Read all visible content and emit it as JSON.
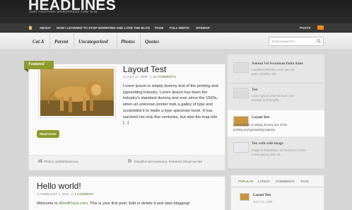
{
  "header": {
    "site_title": "HEADLINES",
    "tagline": "JUST ANOTHER WORDPRESS.COM SITE"
  },
  "topnav": {
    "items": [
      "ABOUT",
      "HOW I LEARNED TO STOP WORRYING AND LOVE THE BLOG",
      "PAGE",
      "FULL-WIDTH",
      "SITEMAP"
    ],
    "posts_label": "POSTS"
  },
  "categories": [
    "Cat A",
    "Parent",
    "Uncategorized",
    "Photos",
    "Quotes"
  ],
  "search": {
    "placeholder": "Enter keywords..."
  },
  "featured_post": {
    "tag": "Featured",
    "title": "Layout Test",
    "date": "JULY 27, 2009",
    "comments": "14 COMMENTS",
    "excerpt": "Lorem Ipsum is simply dummy text of the printing and typesetting industry. Lorem Ipsum has been the industry's standard dummy text ever since the 1500s, when an unknown printer took a galley of type and scrambled it to make a type specimen book. It has survived not only five centuries, but also the leap into [...]",
    "read_more": "Read more",
    "categories": "Photos, publishbusinous",
    "tags": "beautiful and awesome, Featured, things we like"
  },
  "post2": {
    "title": "Hello world!",
    "date": "FEBRUARY 1, 2011",
    "comments": "1 COMMENT",
    "excerpt_before": "Welcome to ",
    "excerpt_link": "WordPress.com",
    "excerpt_after": ". This is your first post. Edit or delete it and start blogging!"
  },
  "sidebar": {
    "items": [
      {
        "title": "Aenean Vel Accumsan Enim Amet",
        "lines": [
          "Curabitur pharetra, enim quis ali-",
          "quet convallis, nisi..."
        ]
      },
      {
        "title": "Test",
        "lines": [
          "Lorem ipsum dolor sit amet, con-",
          "sectetur quis fringilla..."
        ]
      },
      {
        "title": "Layout Test",
        "lines": [
          "Lorem Ipsum is simply dummy text of the",
          "printing and typesetting industry."
        ]
      },
      {
        "title": "Test with wide image",
        "lines": [
          "Image is 900x580px, not resized in editor.",
          "Lorem ipsum dolor sit..."
        ]
      }
    ],
    "tabs": [
      "POPULAR",
      "LATEST",
      "COMMENTS",
      "TAGS"
    ],
    "popular": {
      "title": "Layout Test",
      "date": "JULY 27, 2009"
    }
  },
  "colors": {
    "accent": "#8e9b2d",
    "link": "#4c7a2b",
    "header_bg": "#1f1f1f"
  }
}
